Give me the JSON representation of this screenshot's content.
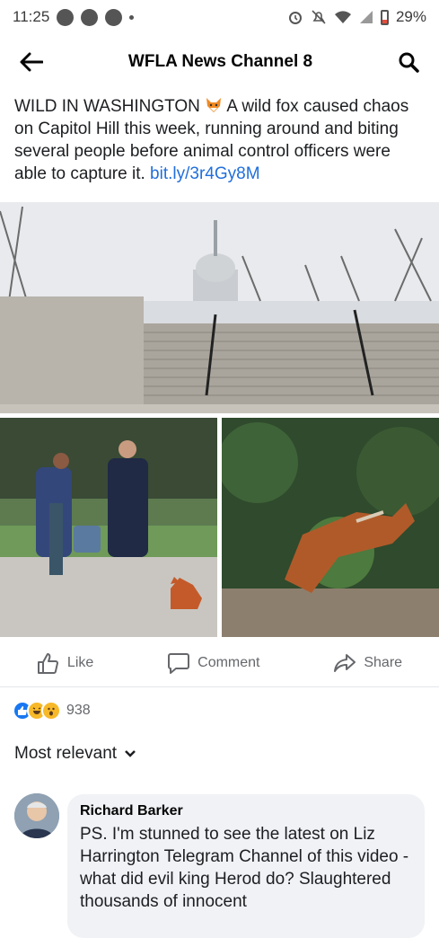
{
  "status_bar": {
    "time": "11:25",
    "battery": "29%"
  },
  "header": {
    "title": "WFLA News Channel 8"
  },
  "post": {
    "text": "WILD IN WASHINGTON",
    "text_rest": " A wild fox caused chaos on Capitol Hill this week, running around and biting several people before animal control officers were able to capture it. ",
    "link": "bit.ly/3r4Gy8M"
  },
  "actions": {
    "like": "Like",
    "comment": "Comment",
    "share": "Share"
  },
  "reactions": {
    "count": "938"
  },
  "comments": {
    "sort_label": "Most relevant",
    "items": [
      {
        "author": "Richard Barker",
        "text": "PS.  I'm stunned to see the latest on Liz Harrington Telegram Channel of this video - what did evil king Herod do? Slaughtered thousands of innocent"
      }
    ]
  },
  "colors": {
    "link": "#216fdb",
    "like_blue": "#1877f2",
    "haha_yellow": "#f7b928"
  }
}
